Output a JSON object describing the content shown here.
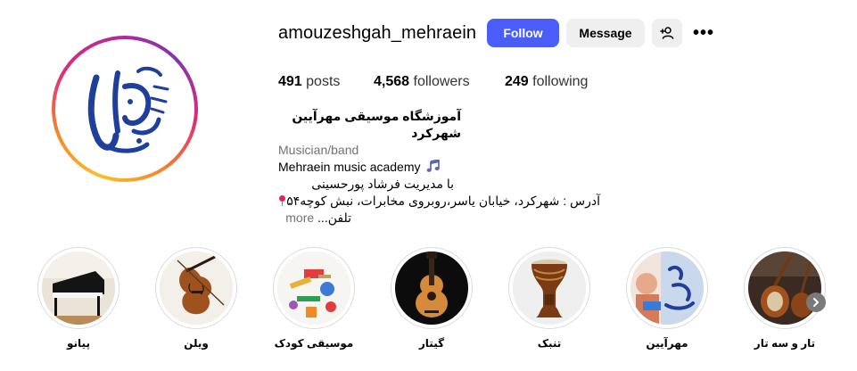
{
  "profile": {
    "username": "amouzeshgah_mehraein",
    "avatar_alt": "logo",
    "follow_label": "Follow",
    "message_label": "Message",
    "adduser_icon": "person-plus-icon",
    "more_icon": "more-options-icon",
    "more_glyph": "•••",
    "posts_count": "491",
    "posts_label": "posts",
    "followers_count": "4,568",
    "followers_label": "followers",
    "following_count": "249",
    "following_label": "following",
    "colors": {
      "follow": "#4a5df9",
      "secondary_btn": "#efefef",
      "muted": "#737373"
    }
  },
  "bio": {
    "name": "آموزشگاه موسیقی مهرآیین شهرکرد",
    "category": "Musician/band",
    "line_english": "Mehraein music academy",
    "line1": "با مدیریت فرشاد پورحسینی",
    "line2": "آدرس : شهرکرد، خیابان یاسر،روبروی مخابرات، نبش کوچه۵۴",
    "line3": "تلفن...",
    "more_label": "more"
  },
  "highlights": [
    {
      "label": "پیانو",
      "icon": "piano-image"
    },
    {
      "label": "ویلن",
      "icon": "violin-image"
    },
    {
      "label": "موسیقی کودک",
      "icon": "kids-instruments-image"
    },
    {
      "label": "گیتار",
      "icon": "guitar-image"
    },
    {
      "label": "تنبک",
      "icon": "tombak-image"
    },
    {
      "label": "مهرآیین",
      "icon": "mehraein-image"
    },
    {
      "label": "تار و سه تار",
      "icon": "tar-setar-image"
    }
  ]
}
